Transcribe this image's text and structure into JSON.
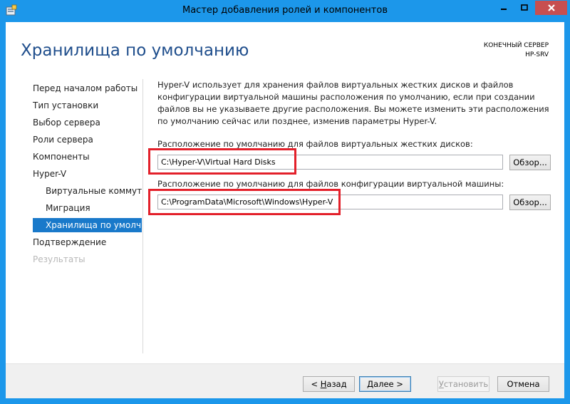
{
  "window": {
    "title": "Мастер добавления ролей и компонентов",
    "icons": {
      "app": "server-manager-icon",
      "minimize": "minimize-icon",
      "maximize": "maximize-icon",
      "close": "close-icon"
    },
    "colors": {
      "frame": "#1c97ea",
      "close": "#c74f50",
      "active_nav": "#1979ca",
      "title_text": "#1f4e8c",
      "highlight": "#e3202a"
    }
  },
  "page": {
    "title": "Хранилища по умолчанию",
    "server_label": "КОНЕЧНЫЙ СЕРВЕР",
    "server_name": "HP-SRV"
  },
  "nav": {
    "items": [
      {
        "label": "Перед началом работы",
        "state": "normal"
      },
      {
        "label": "Тип установки",
        "state": "normal"
      },
      {
        "label": "Выбор сервера",
        "state": "normal"
      },
      {
        "label": "Роли сервера",
        "state": "normal"
      },
      {
        "label": "Компоненты",
        "state": "normal"
      },
      {
        "label": "Hyper-V",
        "state": "normal"
      },
      {
        "label": "Виртуальные коммут...",
        "state": "sub"
      },
      {
        "label": "Миграция",
        "state": "sub"
      },
      {
        "label": "Хранилища по умолч...",
        "state": "active"
      },
      {
        "label": "Подтверждение",
        "state": "normal"
      },
      {
        "label": "Результаты",
        "state": "disabled"
      }
    ]
  },
  "content": {
    "description": "Hyper-V использует для хранения файлов виртуальных жестких дисков и файлов конфигурации виртуальной машины расположения по умолчанию, если при создании файлов вы не указываете другие расположения. Вы можете изменить эти расположения по умолчанию сейчас или позднее, изменив параметры Hyper-V.",
    "vhd_label": "Расположение по умолчанию для файлов виртуальных жестких дисков:",
    "vhd_path": "C:\\Hyper-V\\Virtual Hard Disks",
    "config_label": "Расположение по умолчанию для файлов конфигурации виртуальной машины:",
    "config_path": "C:\\ProgramData\\Microsoft\\Windows\\Hyper-V",
    "browse_label": "Обзор..."
  },
  "footer": {
    "back": "< Назад",
    "back_accel": "Н",
    "back_rest": "азад",
    "next": "Далее >",
    "install": "Установить",
    "install_accel": "У",
    "install_rest": "становить",
    "cancel": "Отмена"
  }
}
